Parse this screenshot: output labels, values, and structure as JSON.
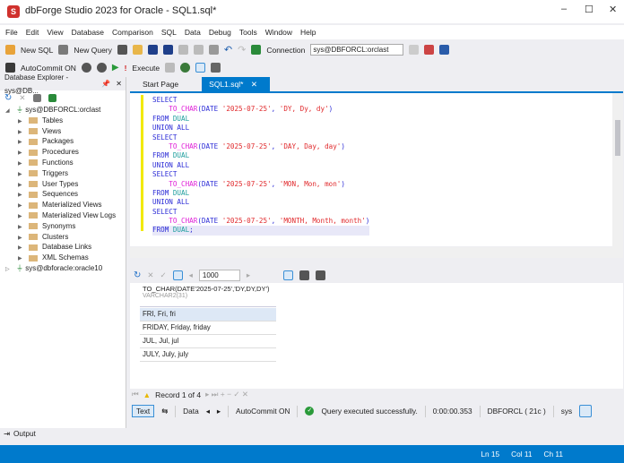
{
  "window": {
    "title": "dbForge Studio 2023 for Oracle - SQL1.sql*",
    "logo": "S",
    "minimize": "‒",
    "maximize": "☐",
    "close": "✕"
  },
  "menu": [
    "File",
    "Edit",
    "View",
    "Database",
    "Comparison",
    "SQL",
    "Data",
    "Debug",
    "Tools",
    "Window",
    "Help"
  ],
  "toolbar1": {
    "new_sql": "New SQL",
    "new_query": "New Query",
    "connection_label": "Connection",
    "connection_value": "sys@DBFORCL:orclast"
  },
  "toolbar2": {
    "autocommit": "AutoCommit ON",
    "execute": "Execute"
  },
  "explorer": {
    "title": "Database Explorer - sys@DB...",
    "pin": "📌",
    "close": "✕",
    "connections": [
      {
        "name": "sys@DBFORCL:orclast",
        "expanded": true,
        "children": [
          "Tables",
          "Views",
          "Packages",
          "Procedures",
          "Functions",
          "Triggers",
          "User Types",
          "Sequences",
          "Materialized Views",
          "Materialized View Logs",
          "Synonyms",
          "Clusters",
          "Database Links",
          "XML Schemas"
        ]
      },
      {
        "name": "sys@dbforacle:oracle10",
        "expanded": false
      }
    ]
  },
  "tabs": [
    {
      "label": "Start Page",
      "active": false
    },
    {
      "label": "SQL1.sql*",
      "active": true
    }
  ],
  "tab_close": "✕",
  "editor": {
    "lines": [
      [
        [
          "kw",
          "SELECT"
        ]
      ],
      [
        [
          "",
          "    "
        ],
        [
          "fn",
          "TO_CHAR"
        ],
        [
          "kw",
          "(DATE "
        ],
        [
          "st",
          "'2025-07-25'"
        ],
        [
          "kw",
          ", "
        ],
        [
          "st",
          "'DY, Dy, dy'"
        ],
        [
          "kw",
          ")"
        ]
      ],
      [
        [
          "kw",
          "FROM "
        ],
        [
          "tbl",
          "DUAL"
        ]
      ],
      [
        [
          "kw",
          "UNION ALL"
        ]
      ],
      [
        [
          "kw",
          "SELECT"
        ]
      ],
      [
        [
          "",
          "    "
        ],
        [
          "fn",
          "TO_CHAR"
        ],
        [
          "kw",
          "(DATE "
        ],
        [
          "st",
          "'2025-07-25'"
        ],
        [
          "kw",
          ", "
        ],
        [
          "st",
          "'DAY, Day, day'"
        ],
        [
          "kw",
          ")"
        ]
      ],
      [
        [
          "kw",
          "FROM "
        ],
        [
          "tbl",
          "DUAL"
        ]
      ],
      [
        [
          "kw",
          "UNION ALL"
        ]
      ],
      [
        [
          "kw",
          "SELECT"
        ]
      ],
      [
        [
          "",
          "    "
        ],
        [
          "fn",
          "TO_CHAR"
        ],
        [
          "kw",
          "(DATE "
        ],
        [
          "st",
          "'2025-07-25'"
        ],
        [
          "kw",
          ", "
        ],
        [
          "st",
          "'MON, Mon, mon'"
        ],
        [
          "kw",
          ")"
        ]
      ],
      [
        [
          "kw",
          "FROM "
        ],
        [
          "tbl",
          "DUAL"
        ]
      ],
      [
        [
          "kw",
          "UNION ALL"
        ]
      ],
      [
        [
          "kw",
          "SELECT"
        ]
      ],
      [
        [
          "",
          "    "
        ],
        [
          "fn",
          "TO_CHAR"
        ],
        [
          "kw",
          "(DATE "
        ],
        [
          "st",
          "'2025-07-25'"
        ],
        [
          "kw",
          ", "
        ],
        [
          "st",
          "'MONTH, Month, month'"
        ],
        [
          "kw",
          ")"
        ]
      ],
      [
        [
          "kw",
          "FROM "
        ],
        [
          "tbl",
          "DUAL"
        ],
        [
          "kw",
          ";"
        ]
      ]
    ]
  },
  "results": {
    "page_size": "1000",
    "column": {
      "header": "TO_CHAR(DATE'2025-07-25','DY,DY,DY')",
      "type": "VARCHAR2(31)"
    },
    "rows": [
      "FRI, Fri, fri",
      "FRIDAY, Friday, friday",
      "JUL, Jul, jul",
      "JULY, July, july"
    ],
    "record_nav": "Record 1 of 4"
  },
  "bottom": {
    "text": "Text",
    "data": "Data",
    "autocommit": "AutoCommit ON",
    "message": "Query executed successfully.",
    "time": "0:00:00.353",
    "server": "DBFORCL ( 21c )",
    "user": "sys"
  },
  "output": "Output",
  "status": {
    "ln": "Ln 15",
    "col": "Col 11",
    "ch": "Ch 11"
  },
  "colors": {
    "accent": "#007acc",
    "keyword": "#2b2bd6",
    "function": "#e020d8",
    "string": "#e0282b"
  }
}
